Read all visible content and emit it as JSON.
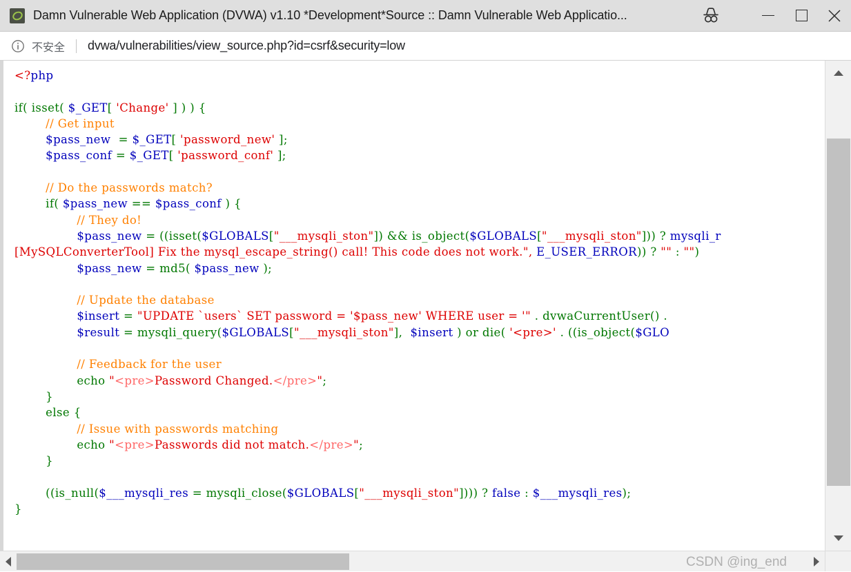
{
  "window": {
    "title": "Damn Vulnerable Web Application (DVWA) v1.10 *Development*Source :: Damn Vulnerable Web Applicatio...",
    "favicon_name": "dvwa-favicon",
    "buttons": {
      "incognito": "incognito-icon",
      "minimize": "−",
      "maximize": "□",
      "close": "✕"
    }
  },
  "address_bar": {
    "security_icon": "info-circle-icon",
    "security_label": "不安全",
    "url": "dvwa/vulnerabilities/view_source.php?id=csrf&security=low"
  },
  "code": {
    "language": "php",
    "lines": [
      "<?php",
      "",
      "if( isset( $_GET[ 'Change' ] ) ) {",
      "    // Get input",
      "    $pass_new  = $_GET[ 'password_new' ];",
      "    $pass_conf = $_GET[ 'password_conf' ];",
      "",
      "    // Do the passwords match?",
      "    if( $pass_new == $pass_conf ) {",
      "        // They do!",
      "        $pass_new = ((isset($GLOBALS[\"___mysqli_ston\"]) && is_object($GLOBALS[\"___mysqli_ston\"])) ? mysqli_r",
      "[MySQLConverterTool] Fix the mysql_escape_string() call! This code does not work.\", E_USER_ERROR)) ? \"\" : \"\")",
      "        $pass_new = md5( $pass_new );",
      "",
      "        // Update the database",
      "        $insert = \"UPDATE `users` SET password = '$pass_new' WHERE user = '\" . dvwaCurrentUser() .",
      "        $result = mysqli_query($GLOBALS[\"___mysqli_ston\"],  $insert ) or die( '<pre>' . ((is_object($GLO",
      "",
      "        // Feedback for the user",
      "        echo \"<pre>Password Changed.</pre>\";",
      "    }",
      "    else {",
      "        // Issue with passwords matching",
      "        echo \"<pre>Passwords did not match.</pre>\";",
      "    }",
      "",
      "    ((is_null($___mysqli_res = mysqli_close($GLOBALS[\"___mysqli_ston\"]))) ? false : $___mysqli_res);",
      "}",
      "",
      "",
      "?>"
    ]
  },
  "scrollbars": {
    "vertical": {
      "up_arrow": "▲",
      "down_arrow": "▼",
      "thumb_top_pct": 12,
      "thumb_height_pct": 79
    },
    "horizontal": {
      "left_arrow": "◀",
      "right_arrow": "▶",
      "thumb_left_pct": 0,
      "thumb_width_pct": 42
    }
  },
  "watermark": {
    "text": "CSDN @ing_end"
  },
  "colors": {
    "keyword": "#007700",
    "variable": "#0000bb",
    "string": "#dd0000",
    "comment": "#ff8000",
    "html_tag": "#ff6666",
    "chrome_titlebar": "#dfdfdf",
    "scrollbar_thumb": "#c1c1c1"
  }
}
